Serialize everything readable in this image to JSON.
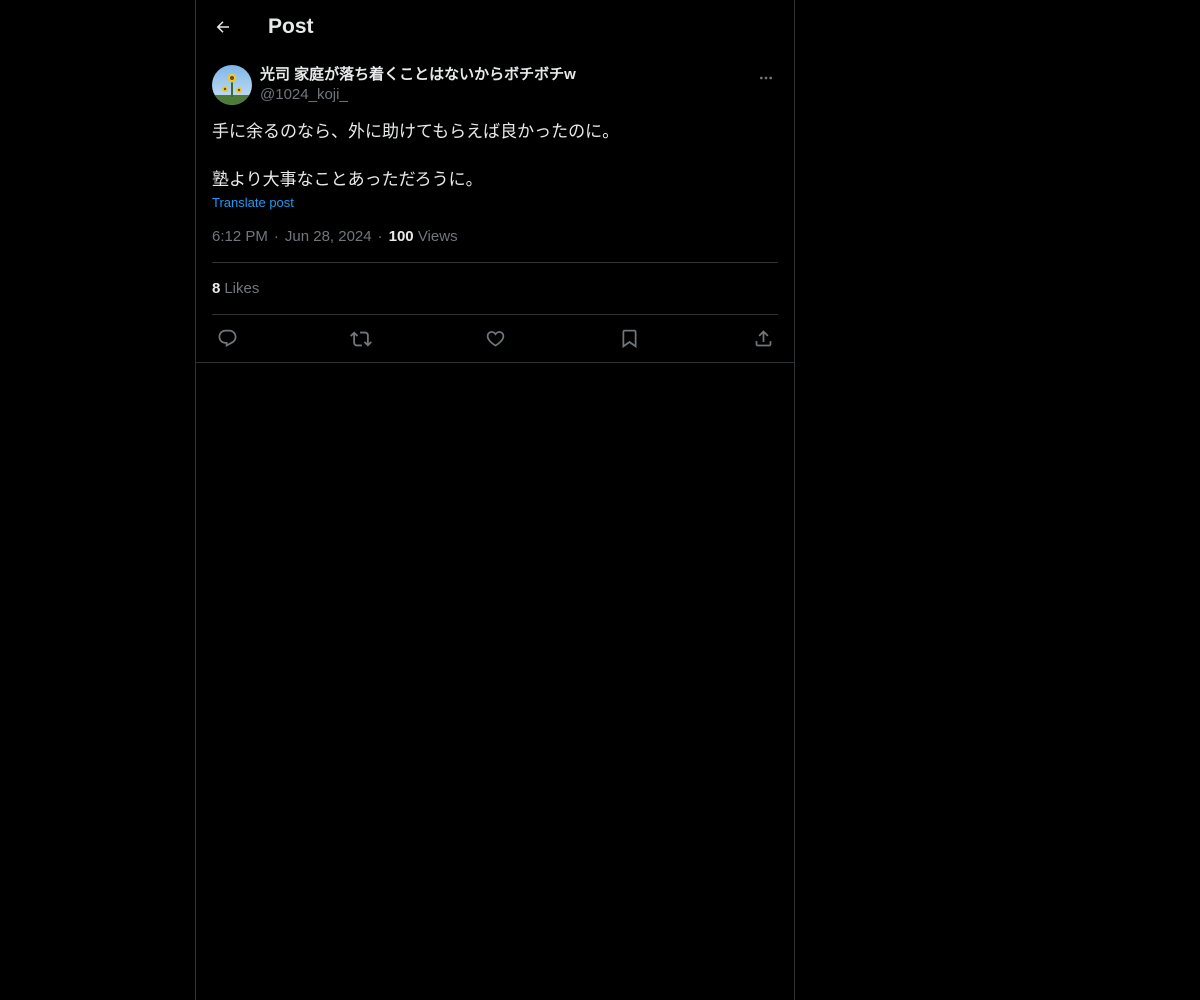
{
  "header": {
    "title": "Post"
  },
  "post": {
    "author": {
      "display_name": "光司 家庭が落ち着くことはないからボチボチw",
      "handle": "@1024_koji_"
    },
    "text_lines": [
      "手に余るのなら、外に助けてもらえば良かったのに。",
      "塾より大事なことあっただろうに。"
    ],
    "translate_label": "Translate post",
    "time": "6:12 PM",
    "date": "Jun 28, 2024",
    "separator": "·",
    "views_count": "100",
    "views_label": "Views",
    "likes_count": "8",
    "likes_label": "Likes"
  },
  "icons": {
    "back": "arrow-left-icon",
    "more": "more-horizontal-icon",
    "reply": "reply-icon",
    "repost": "repost-icon",
    "like": "heart-icon",
    "bookmark": "bookmark-icon",
    "share": "share-icon"
  },
  "colors": {
    "background": "#000000",
    "text": "#e7e9ea",
    "muted": "#71767b",
    "link": "#1d9bf0",
    "border": "#2f3336"
  }
}
